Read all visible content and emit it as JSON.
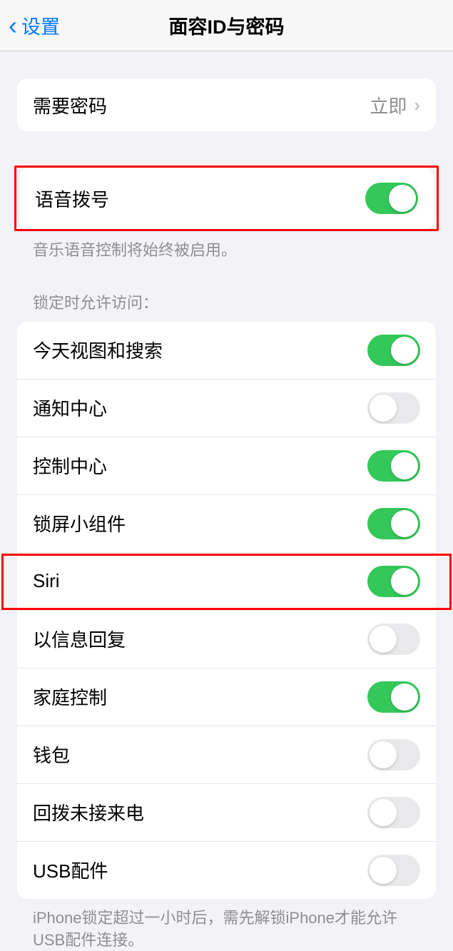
{
  "header": {
    "back_label": "设置",
    "title": "面容ID与密码"
  },
  "passcode": {
    "label": "需要密码",
    "value": "立即"
  },
  "voice_dial": {
    "label": "语音拨号",
    "on": true,
    "footer": "音乐语音控制将始终被启用。"
  },
  "lock_section": {
    "header": "锁定时允许访问：",
    "items": [
      {
        "label": "今天视图和搜索",
        "on": true
      },
      {
        "label": "通知中心",
        "on": false
      },
      {
        "label": "控制中心",
        "on": true
      },
      {
        "label": "锁屏小组件",
        "on": true
      },
      {
        "label": "Siri",
        "on": true,
        "highlight": true
      },
      {
        "label": "以信息回复",
        "on": false
      },
      {
        "label": "家庭控制",
        "on": true
      },
      {
        "label": "钱包",
        "on": false
      },
      {
        "label": "回拨未接来电",
        "on": false
      },
      {
        "label": "USB配件",
        "on": false
      }
    ],
    "footer": "iPhone锁定超过一小时后，需先解锁iPhone才能允许USB配件连接。"
  }
}
